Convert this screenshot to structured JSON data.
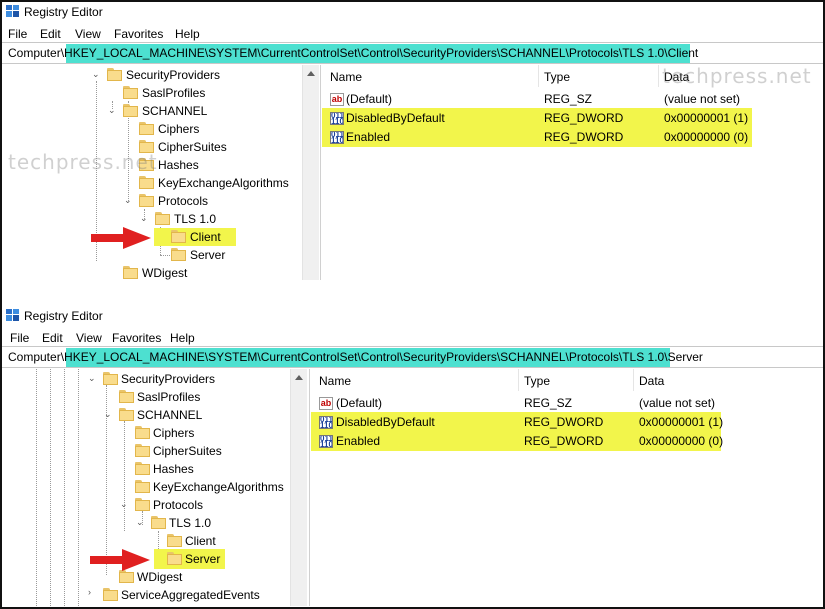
{
  "watermark_text": "techpress.net",
  "colors": {
    "highlight_yellow": "#f2f54b",
    "address_cyan": "#4de0d0",
    "arrow_red": "#e02020"
  },
  "top_window": {
    "title": "Registry Editor",
    "menu": [
      "File",
      "Edit",
      "View",
      "Favorites",
      "Help"
    ],
    "address": "Computer\\HKEY_LOCAL_MACHINE\\SYSTEM\\CurrentControlSet\\Control\\SecurityProviders\\SCHANNEL\\Protocols\\TLS 1.0\\Client",
    "tree": [
      "SecurityProviders",
      "SaslProfiles",
      "SCHANNEL",
      "Ciphers",
      "CipherSuites",
      "Hashes",
      "KeyExchangeAlgorithms",
      "Protocols",
      "TLS 1.0",
      "Client",
      "Server",
      "WDigest"
    ],
    "selected_key": "Client",
    "columns": {
      "name": "Name",
      "type": "Type",
      "data": "Data"
    },
    "values": [
      {
        "name": "(Default)",
        "type": "REG_SZ",
        "data": "(value not set)",
        "icon": "reg-sz-icon"
      },
      {
        "name": "DisabledByDefault",
        "type": "REG_DWORD",
        "data": "0x00000001 (1)",
        "icon": "reg-dword-icon"
      },
      {
        "name": "Enabled",
        "type": "REG_DWORD",
        "data": "0x00000000 (0)",
        "icon": "reg-dword-icon"
      }
    ]
  },
  "bottom_window": {
    "title": "Registry Editor",
    "menu": [
      "File",
      "Edit",
      "View",
      "Favorites",
      "Help"
    ],
    "address": "Computer\\HKEY_LOCAL_MACHINE\\SYSTEM\\CurrentControlSet\\Control\\SecurityProviders\\SCHANNEL\\Protocols\\TLS 1.0\\Server",
    "tree": [
      "SecurityProviders",
      "SaslProfiles",
      "SCHANNEL",
      "Ciphers",
      "CipherSuites",
      "Hashes",
      "KeyExchangeAlgorithms",
      "Protocols",
      "TLS 1.0",
      "Client",
      "Server",
      "WDigest",
      "ServiceAggregatedEvents"
    ],
    "selected_key": "Server",
    "columns": {
      "name": "Name",
      "type": "Type",
      "data": "Data"
    },
    "values": [
      {
        "name": "(Default)",
        "type": "REG_SZ",
        "data": "(value not set)",
        "icon": "reg-sz-icon"
      },
      {
        "name": "DisabledByDefault",
        "type": "REG_DWORD",
        "data": "0x00000001 (1)",
        "icon": "reg-dword-icon"
      },
      {
        "name": "Enabled",
        "type": "REG_DWORD",
        "data": "0x00000000 (0)",
        "icon": "reg-dword-icon"
      }
    ]
  }
}
